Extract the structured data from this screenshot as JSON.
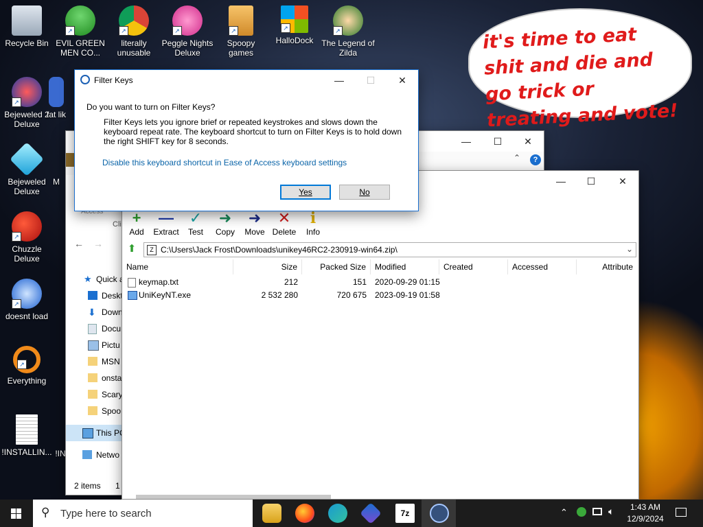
{
  "desktop": {
    "icons": [
      {
        "label": "Recycle Bin",
        "icon": "recycle-bin-icon"
      },
      {
        "label": "EVIL GREEN MEN CO...",
        "icon": "green-men-icon"
      },
      {
        "label": "literally unusable",
        "icon": "chrome-icon"
      },
      {
        "label": "Peggle Nights Deluxe",
        "icon": "peggle-icon"
      },
      {
        "label": "Spoopy games",
        "icon": "folder-icon"
      },
      {
        "label": "HalloDock",
        "icon": "windows-logo-icon"
      },
      {
        "label": "The Legend of Zilda",
        "icon": "zelda-icon"
      },
      {
        "label": "Bejeweled 2 Deluxe",
        "icon": "bejeweled2-icon"
      },
      {
        "label": "fat lik",
        "icon": "fat-icon"
      },
      {
        "label": "Bejeweled Deluxe",
        "icon": "gem-icon"
      },
      {
        "label": "M",
        "icon": "partial-icon"
      },
      {
        "label": "Chuzzle Deluxe",
        "icon": "chuzzle-icon"
      },
      {
        "label": "doesnt load",
        "icon": "thunderbird-icon"
      },
      {
        "label": "Everything",
        "icon": "everything-icon"
      },
      {
        "label": "!INSTALLIN...",
        "icon": "text-file-icon"
      },
      {
        "label": "!IN",
        "icon": "partial-icon"
      }
    ],
    "bubble_text": "it's time to eat shit and die and go trick or treating and vote!"
  },
  "explorer": {
    "title_buttons": {
      "minimize": "—",
      "maximize": "☐",
      "close": "✕"
    },
    "ribbon_text": "Access",
    "clip_text": "Cli",
    "nav_items": [
      {
        "label": "Quick a",
        "icon": "star-icon"
      },
      {
        "label": "Deskt",
        "icon": "desktop-icon"
      },
      {
        "label": "Down",
        "icon": "download-icon"
      },
      {
        "label": "Docu",
        "icon": "document-icon"
      },
      {
        "label": "Pictu",
        "icon": "pictures-icon"
      },
      {
        "label": "MSN",
        "icon": "folder-icon"
      },
      {
        "label": "onsta",
        "icon": "folder-icon"
      },
      {
        "label": "Scary",
        "icon": "folder-icon"
      },
      {
        "label": "Spoo",
        "icon": "folder-icon"
      },
      {
        "label": "This PC",
        "icon": "pc-icon"
      },
      {
        "label": "Netwo",
        "icon": "network-icon"
      }
    ],
    "status_left": "2 items",
    "status_right": "1"
  },
  "sevenzip": {
    "title_buttons": {
      "minimize": "—",
      "maximize": "☐",
      "close": "✕"
    },
    "toolbar": [
      {
        "label": "Add",
        "glyph": "+",
        "color": "#2e9e2e",
        "icon": "add-icon"
      },
      {
        "label": "Extract",
        "glyph": "—",
        "color": "#1e3aa8",
        "icon": "extract-icon"
      },
      {
        "label": "Test",
        "glyph": "✓",
        "color": "#1aa5a5",
        "icon": "test-icon"
      },
      {
        "label": "Copy",
        "glyph": "➜",
        "color": "#1a8a5a",
        "icon": "copy-icon"
      },
      {
        "label": "Move",
        "glyph": "➜",
        "color": "#1e2e8a",
        "icon": "move-icon"
      },
      {
        "label": "Delete",
        "glyph": "✕",
        "color": "#d01c1c",
        "icon": "delete-icon"
      },
      {
        "label": "Info",
        "glyph": "i",
        "color": "#e0b000",
        "icon": "info-icon"
      }
    ],
    "path": "C:\\Users\\Jack Frost\\Downloads\\unikey46RC2-230919-win64.zip\\",
    "columns": [
      "Name",
      "Size",
      "Packed Size",
      "Modified",
      "Created",
      "Accessed",
      "Attribute"
    ],
    "rows": [
      {
        "name": "keymap.txt",
        "size": "212",
        "packed": "151",
        "modified": "2020-09-29 01:15",
        "icon": "text-file-icon"
      },
      {
        "name": "UniKeyNT.exe",
        "size": "2 532 280",
        "packed": "720 675",
        "modified": "2023-09-19 01:58",
        "icon": "exe-file-icon"
      }
    ]
  },
  "dialog": {
    "title": "Filter Keys",
    "title_buttons": {
      "minimize": "—",
      "maximize": "☐",
      "close": "✕"
    },
    "question": "Do you want to turn on Filter Keys?",
    "body": "Filter Keys lets you ignore brief or repeated keystrokes and slows down the keyboard repeat rate.  The keyboard shortcut to turn on Filter Keys is to hold down the right SHIFT key for 8 seconds.",
    "link": "Disable this keyboard shortcut in Ease of Access keyboard settings",
    "yes_label": "Yes",
    "no_label": "No"
  },
  "taskbar": {
    "search_placeholder": "Type here to search",
    "time": "1:43 AM",
    "date": "12/9/2024",
    "apps": [
      "file-explorer-icon",
      "firefox-icon",
      "edge-icon",
      "vscode-icon",
      "sevenzip-icon",
      "accessibility-icon"
    ],
    "sevenzip_label": "7z",
    "tray": [
      "chevron-up-icon",
      "user-icon",
      "network-icon",
      "volume-icon"
    ]
  },
  "colors": {
    "accent": "#0a64a8",
    "link": "#0a64a8",
    "bubble_text": "#e01b1b",
    "taskbar": "#1c1c1c"
  }
}
